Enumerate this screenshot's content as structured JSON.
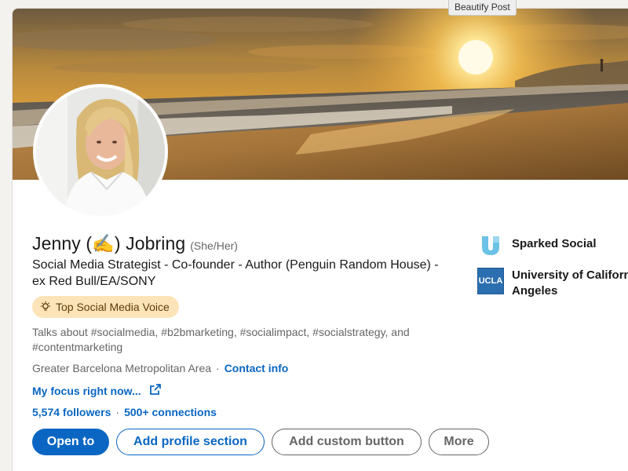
{
  "tooltip": "Beautify Post",
  "profile": {
    "name": "Jenny (✍️) Jobring",
    "pronouns": "(She/Her)",
    "headline": "Social Media Strategist - Co-founder - Author (Penguin Random House) - ex Red Bull/EA/SONY",
    "badge": "Top Social Media Voice",
    "talks_about": "Talks about #socialmedia, #b2bmarketing, #socialimpact, #socialstrategy, and #contentmarketing",
    "location": "Greater Barcelona Metropolitan Area",
    "location_separator": "·",
    "contact_info": "Contact info",
    "focus_link": "My focus right now...",
    "followers": "5,574 followers",
    "stats_separator": "·",
    "connections": "500+ connections"
  },
  "actions": {
    "open_to": "Open to",
    "add_section": "Add profile section",
    "add_custom": "Add custom button",
    "more": "More"
  },
  "sidebar": {
    "company": "Sparked Social",
    "school_line1": "University of California, Los",
    "school_line2": "Angeles",
    "school_logo_text": "UCLA"
  },
  "colors": {
    "primary": "#0a66c2",
    "badge_bg": "#fce4b8",
    "text_secondary": "#666666"
  },
  "icons": {
    "badge": "lightbulb-icon",
    "focus": "external-link-icon",
    "company": "sparked-social-logo",
    "school": "ucla-logo"
  }
}
